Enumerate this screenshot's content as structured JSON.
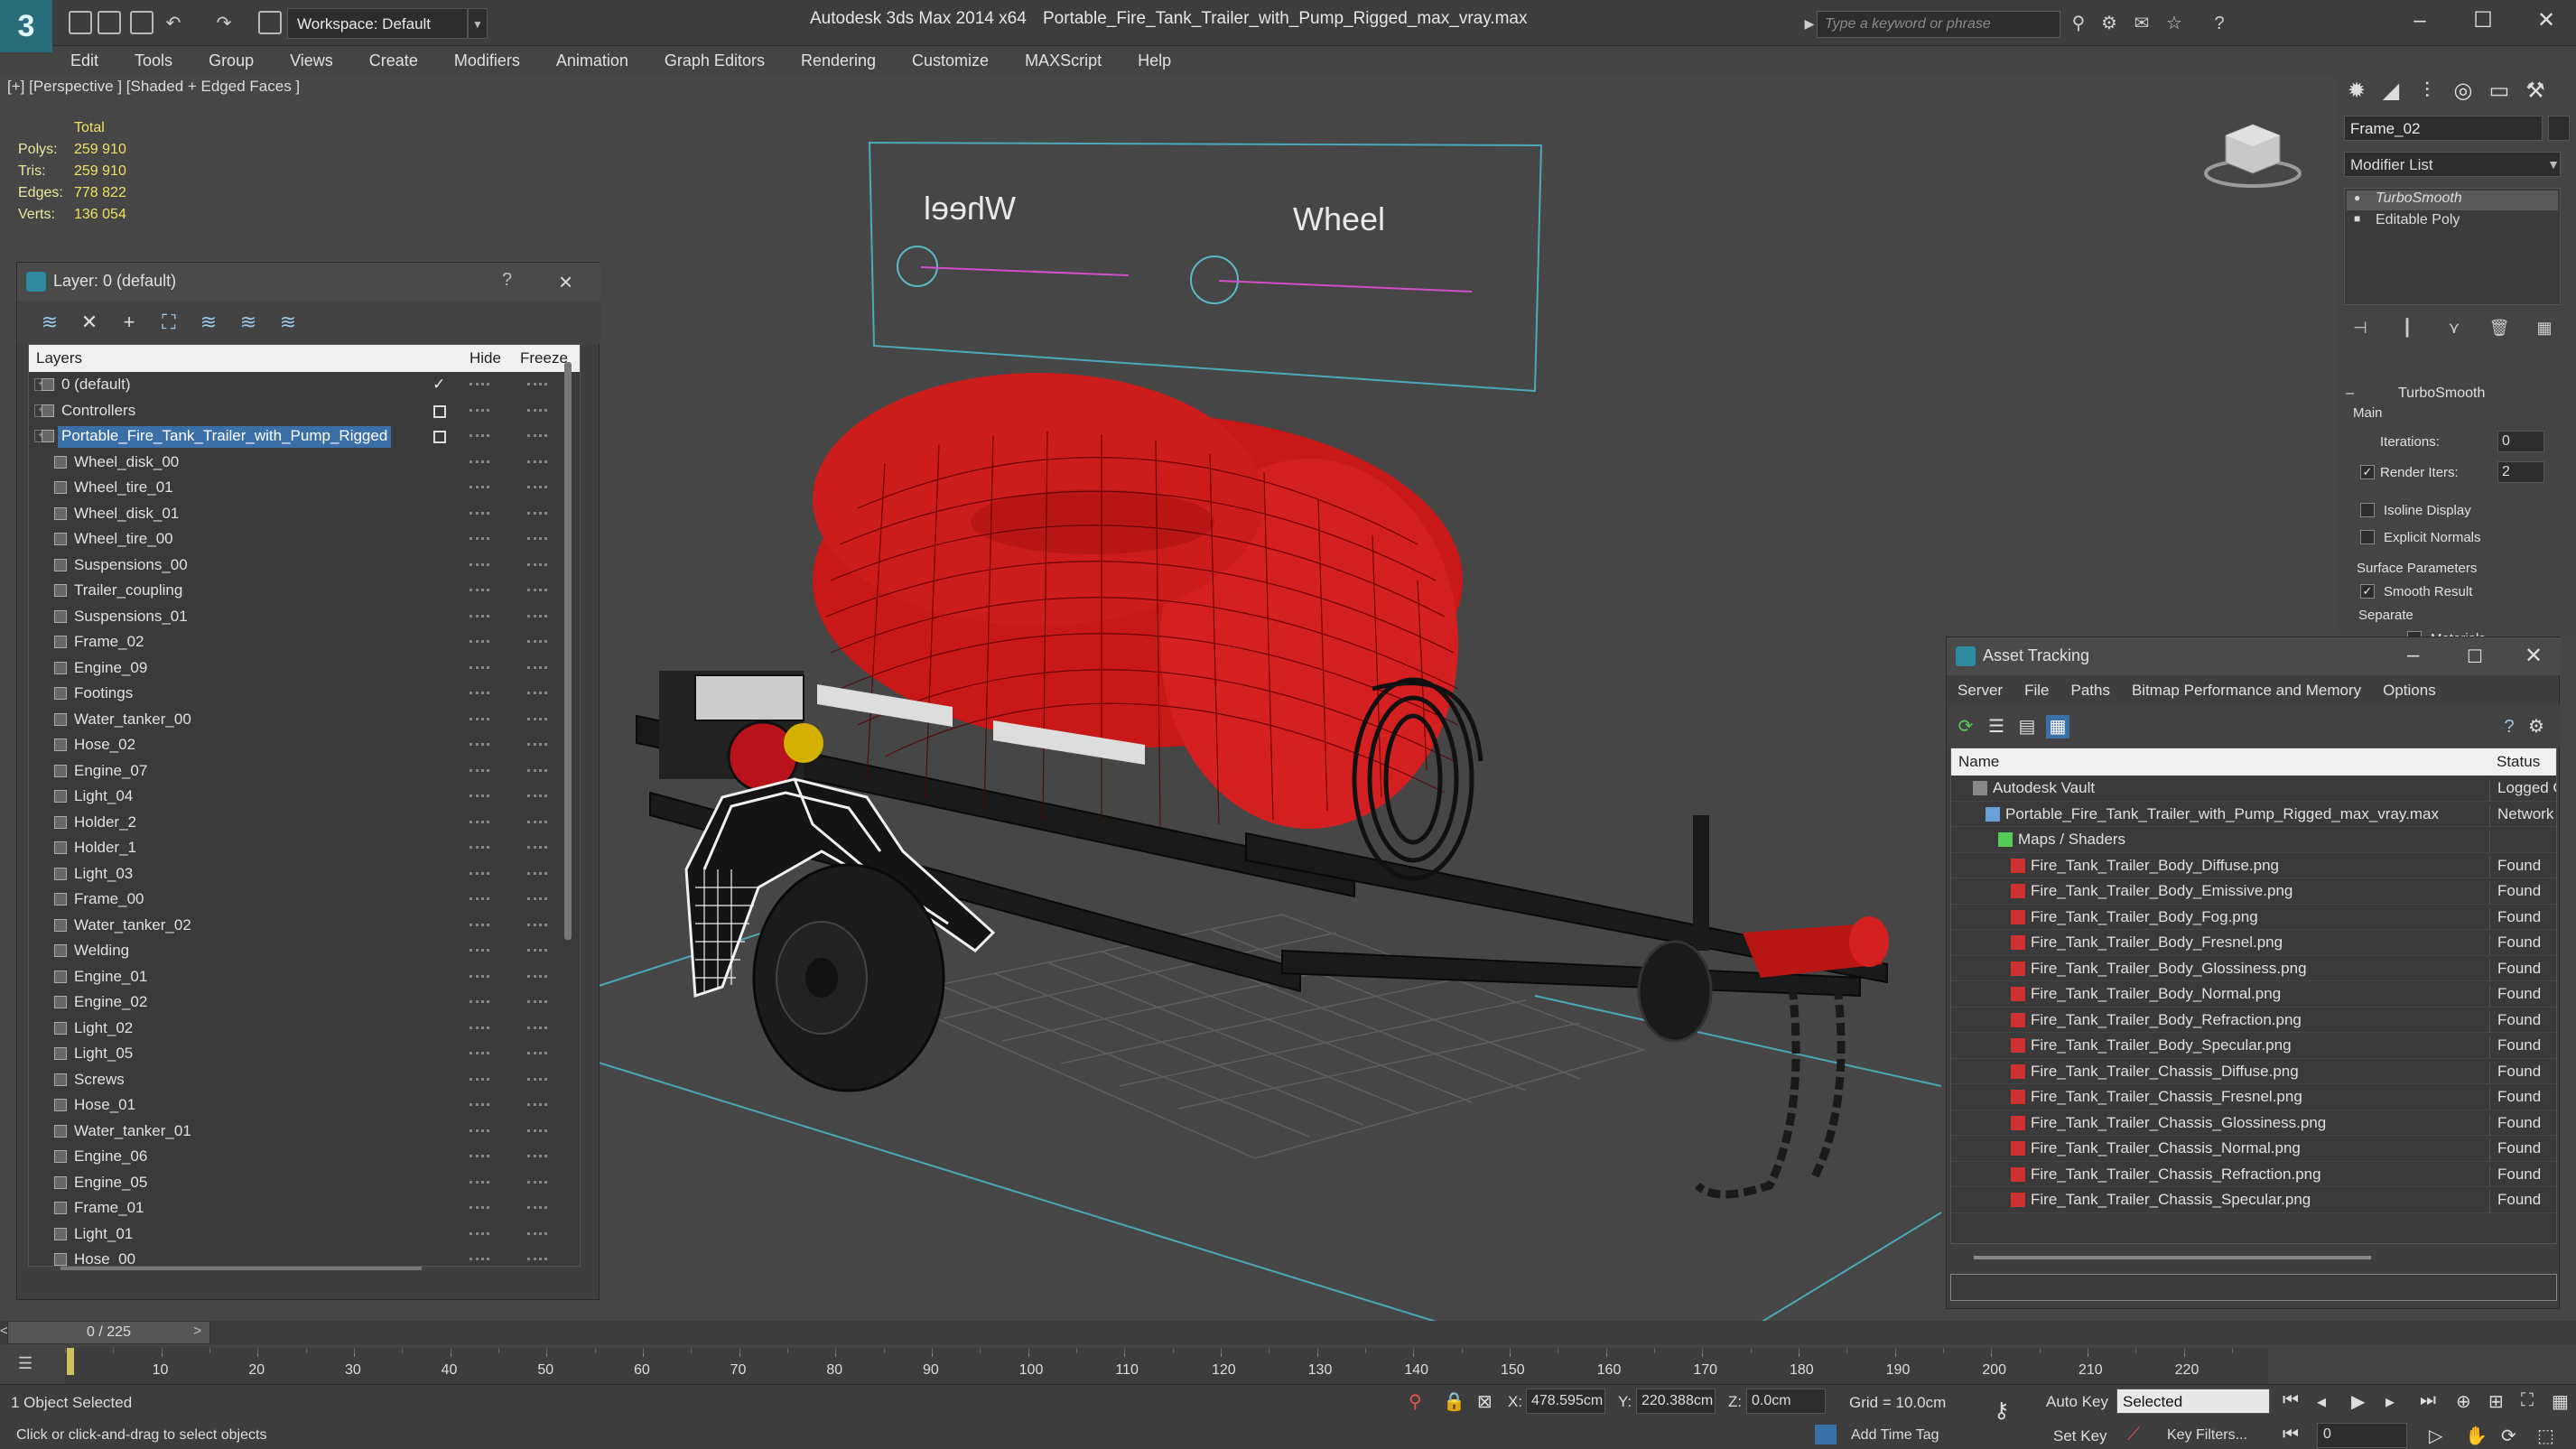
{
  "titlebar": {
    "workspace_label": "Workspace: Default",
    "app_title": "Autodesk 3ds Max  2014 x64",
    "file_title": "Portable_Fire_Tank_Trailer_with_Pump_Rigged_max_vray.max",
    "search_placeholder": "Type a keyword or phrase"
  },
  "menu": [
    "Edit",
    "Tools",
    "Group",
    "Views",
    "Create",
    "Modifiers",
    "Animation",
    "Graph Editors",
    "Rendering",
    "Customize",
    "MAXScript",
    "Help"
  ],
  "viewport": {
    "label": "[+] [Perspective ] [Shaded + Edged Faces ]",
    "stats": {
      "total": "Total",
      "polys_label": "Polys:",
      "polys": "259 910",
      "tris_label": "Tris:",
      "tris": "259 910",
      "edges_label": "Edges:",
      "edges": "778 822",
      "verts_label": "Verts:",
      "verts": "136 054"
    },
    "wheel_label_mirrored": "Wheel",
    "wheel_label": "Wheel"
  },
  "layer_panel": {
    "title": "Layer: 0 (default)",
    "help": "?",
    "columns": {
      "layers": "Layers",
      "hide": "Hide",
      "freeze": "Freeze"
    },
    "rows": [
      {
        "name": "0 (default)",
        "level": 0,
        "state": "check"
      },
      {
        "name": "Controllers",
        "level": 0,
        "state": "box"
      },
      {
        "name": "Portable_Fire_Tank_Trailer_with_Pump_Rigged",
        "level": 0,
        "state": "box",
        "selected": true
      },
      {
        "name": "Wheel_disk_00",
        "level": 1
      },
      {
        "name": "Wheel_tire_01",
        "level": 1
      },
      {
        "name": "Wheel_disk_01",
        "level": 1
      },
      {
        "name": "Wheel_tire_00",
        "level": 1
      },
      {
        "name": "Suspensions_00",
        "level": 1
      },
      {
        "name": "Trailer_coupling",
        "level": 1
      },
      {
        "name": "Suspensions_01",
        "level": 1
      },
      {
        "name": "Frame_02",
        "level": 1
      },
      {
        "name": "Engine_09",
        "level": 1
      },
      {
        "name": "Footings",
        "level": 1
      },
      {
        "name": "Water_tanker_00",
        "level": 1
      },
      {
        "name": "Hose_02",
        "level": 1
      },
      {
        "name": "Engine_07",
        "level": 1
      },
      {
        "name": "Light_04",
        "level": 1
      },
      {
        "name": "Holder_2",
        "level": 1
      },
      {
        "name": "Holder_1",
        "level": 1
      },
      {
        "name": "Light_03",
        "level": 1
      },
      {
        "name": "Frame_00",
        "level": 1
      },
      {
        "name": "Water_tanker_02",
        "level": 1
      },
      {
        "name": "Welding",
        "level": 1
      },
      {
        "name": "Engine_01",
        "level": 1
      },
      {
        "name": "Engine_02",
        "level": 1
      },
      {
        "name": "Light_02",
        "level": 1
      },
      {
        "name": "Light_05",
        "level": 1
      },
      {
        "name": "Screws",
        "level": 1
      },
      {
        "name": "Hose_01",
        "level": 1
      },
      {
        "name": "Water_tanker_01",
        "level": 1
      },
      {
        "name": "Engine_06",
        "level": 1
      },
      {
        "name": "Engine_05",
        "level": 1
      },
      {
        "name": "Frame_01",
        "level": 1
      },
      {
        "name": "Light_01",
        "level": 1
      },
      {
        "name": "Hose_00",
        "level": 1
      }
    ]
  },
  "command_panel": {
    "object_name": "Frame_02",
    "modifier_list": "Modifier List",
    "stack": [
      "TurboSmooth",
      "Editable Poly"
    ],
    "rollout_title": "TurboSmooth",
    "main_label": "Main",
    "iterations_label": "Iterations:",
    "iterations": "0",
    "render_iters_label": "Render Iters:",
    "render_iters": "2",
    "isoline_label": "Isoline Display",
    "explicit_normals_label": "Explicit Normals",
    "surface_params_label": "Surface Parameters",
    "smooth_result_label": "Smooth Result",
    "separate_label": "Separate",
    "materials_label": "Materials"
  },
  "asset_tracking": {
    "title": "Asset Tracking",
    "menu": [
      "Server",
      "File",
      "Paths",
      "Bitmap Performance and Memory",
      "Options"
    ],
    "columns": {
      "name": "Name",
      "status": "Status"
    },
    "rows": [
      {
        "name": "Autodesk Vault",
        "level": 0,
        "status": "Logged Ou",
        "icon": "vault"
      },
      {
        "name": "Portable_Fire_Tank_Trailer_with_Pump_Rigged_max_vray.max",
        "level": 1,
        "status": "Network P",
        "icon": "max"
      },
      {
        "name": "Maps / Shaders",
        "level": 2,
        "status": "",
        "icon": "folder"
      },
      {
        "name": "Fire_Tank_Trailer_Body_Diffuse.png",
        "level": 3,
        "status": "Found",
        "icon": "png"
      },
      {
        "name": "Fire_Tank_Trailer_Body_Emissive.png",
        "level": 3,
        "status": "Found",
        "icon": "png"
      },
      {
        "name": "Fire_Tank_Trailer_Body_Fog.png",
        "level": 3,
        "status": "Found",
        "icon": "png"
      },
      {
        "name": "Fire_Tank_Trailer_Body_Fresnel.png",
        "level": 3,
        "status": "Found",
        "icon": "png"
      },
      {
        "name": "Fire_Tank_Trailer_Body_Glossiness.png",
        "level": 3,
        "status": "Found",
        "icon": "png"
      },
      {
        "name": "Fire_Tank_Trailer_Body_Normal.png",
        "level": 3,
        "status": "Found",
        "icon": "png"
      },
      {
        "name": "Fire_Tank_Trailer_Body_Refraction.png",
        "level": 3,
        "status": "Found",
        "icon": "png"
      },
      {
        "name": "Fire_Tank_Trailer_Body_Specular.png",
        "level": 3,
        "status": "Found",
        "icon": "png"
      },
      {
        "name": "Fire_Tank_Trailer_Chassis_Diffuse.png",
        "level": 3,
        "status": "Found",
        "icon": "png"
      },
      {
        "name": "Fire_Tank_Trailer_Chassis_Fresnel.png",
        "level": 3,
        "status": "Found",
        "icon": "png"
      },
      {
        "name": "Fire_Tank_Trailer_Chassis_Glossiness.png",
        "level": 3,
        "status": "Found",
        "icon": "png"
      },
      {
        "name": "Fire_Tank_Trailer_Chassis_Normal.png",
        "level": 3,
        "status": "Found",
        "icon": "png"
      },
      {
        "name": "Fire_Tank_Trailer_Chassis_Refraction.png",
        "level": 3,
        "status": "Found",
        "icon": "png"
      },
      {
        "name": "Fire_Tank_Trailer_Chassis_Specular.png",
        "level": 3,
        "status": "Found",
        "icon": "png"
      }
    ]
  },
  "timeline": {
    "slider": "0 / 225",
    "ticks": [
      "10",
      "20",
      "30",
      "40",
      "50",
      "60",
      "70",
      "80",
      "90",
      "100",
      "110",
      "120",
      "130",
      "140",
      "150",
      "160",
      "170",
      "180",
      "190",
      "200",
      "210",
      "220"
    ]
  },
  "status": {
    "selection": "1 Object Selected",
    "prompt": "Click or click-and-drag to select objects",
    "x_label": "X:",
    "x": "478.595cm",
    "y_label": "Y:",
    "y": "220.388cm",
    "z_label": "Z:",
    "z": "0.0cm",
    "grid": "Grid = 10.0cm",
    "add_time_tag": "Add Time Tag",
    "auto_key": "Auto Key",
    "set_key": "Set Key",
    "selected_dropdown": "Selected",
    "key_filters": "Key Filters...",
    "frame": "0"
  },
  "colors": {
    "accent": "#3b6fa8",
    "tank_red": "#d42020",
    "wire_cyan": "#5ab8c8",
    "stat_yellow": "#f0e060"
  }
}
